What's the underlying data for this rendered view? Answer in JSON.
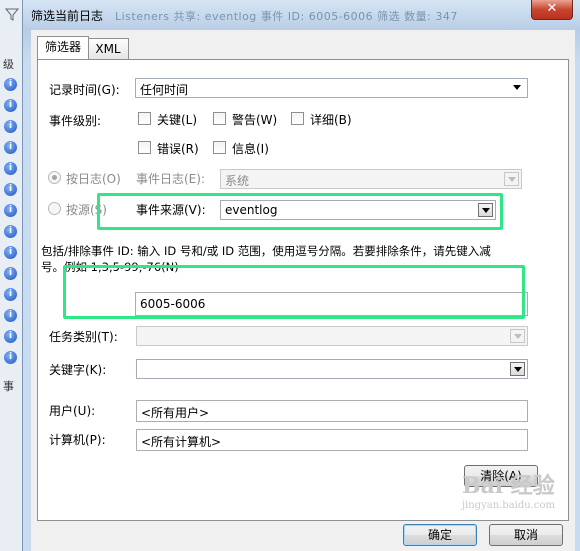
{
  "window": {
    "title": "筛选当前日志",
    "title_ghost": "Listeners 共享: eventlog  事件 ID: 6005-6006  筛选  数量: 347",
    "close_glyph": "✕"
  },
  "background": {
    "labels": [
      "级",
      "事"
    ]
  },
  "tabs": [
    {
      "label": "筛选器"
    },
    {
      "label": "XML"
    }
  ],
  "filter": {
    "logged_label": "记录时间(G):",
    "logged_value": "任何时间",
    "level_label": "事件级别:",
    "levels": [
      {
        "label": "关键(L)"
      },
      {
        "label": "警告(W)"
      },
      {
        "label": "详细(B)"
      },
      {
        "label": "错误(R)"
      },
      {
        "label": "信息(I)"
      }
    ],
    "by_log": {
      "radio_label": "按日志(O)",
      "field_label": "事件日志(E):",
      "value": "系统"
    },
    "by_source": {
      "radio_label": "按源(S)",
      "field_label": "事件来源(V):",
      "value": "eventlog"
    },
    "event_id_description_1": "包括/排除事件 ID: 输入 ID 号和/或 ID 范围，使用逗号分隔。若要排除条件，请先键入减",
    "event_id_description_2": "号。例如 1,3,5-99,-76(N)",
    "event_id_value": "6005-6006",
    "task_category_label": "任务类别(T):",
    "keywords_label": "关键字(K):",
    "user_label": "用户(U):",
    "user_value": "<所有用户>",
    "computer_label": "计算机(P):",
    "computer_value": "<所有计算机>",
    "clear_button": "清除(A)"
  },
  "footer": {
    "ok_button": "确定",
    "cancel_button": "取消"
  },
  "watermark": {
    "text": "Bai 经验",
    "sub": "jingyan.baidu.com"
  },
  "colors": {
    "highlight": "#2ee886",
    "accent": "#3c7fb1"
  }
}
